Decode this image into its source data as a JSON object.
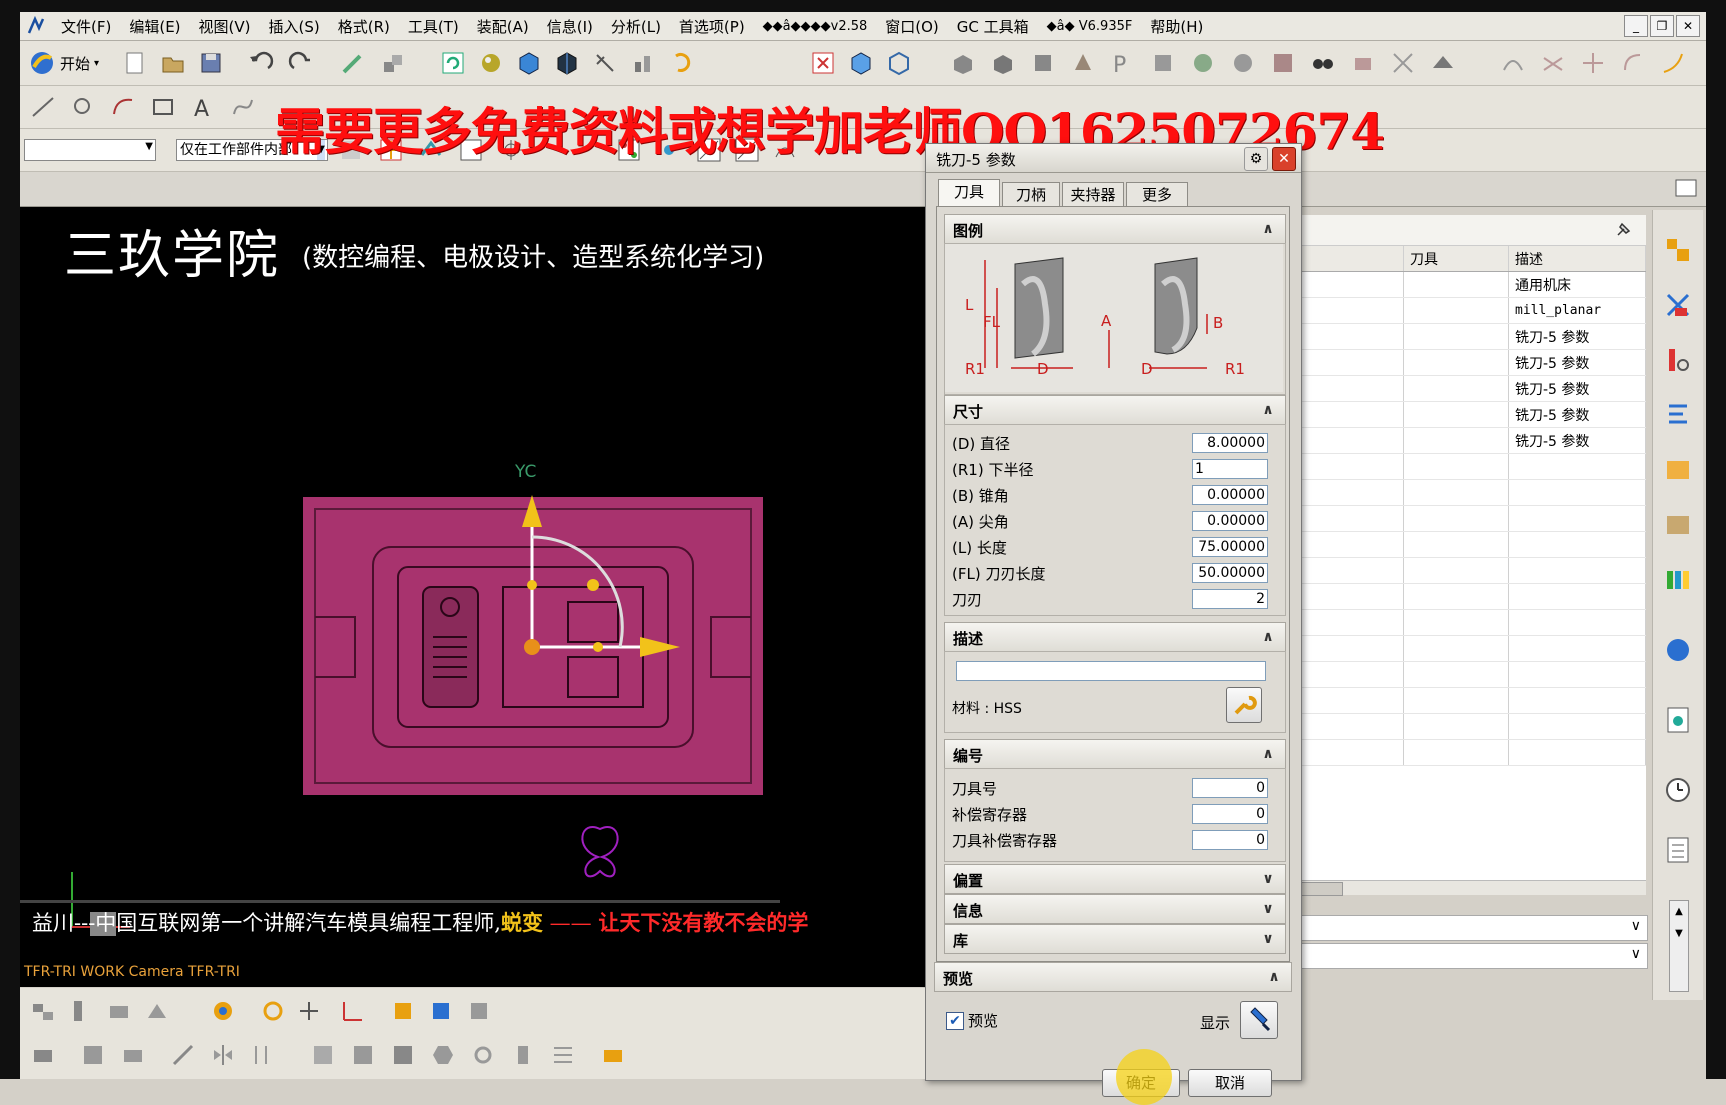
{
  "menubar": {
    "items": [
      "文件(F)",
      "编辑(E)",
      "视图(V)",
      "插入(S)",
      "格式(R)",
      "工具(T)",
      "装配(A)",
      "信息(I)",
      "分析(L)",
      "首选项(P)",
      "◆◆â◆◆◆◆v2.58",
      "窗口(O)",
      "GC 工具箱",
      "◆â◆ V6.935F",
      "帮助(H)"
    ],
    "start_label": "开始"
  },
  "filter": {
    "selection_value": "",
    "scope_value": "仅在工作部件内部"
  },
  "watermark": "需要更多免费资料或想学加老师QQ1625072674",
  "graphics": {
    "academy_title": "三玖学院",
    "academy_subtitle": "(数控编程、电极设计、造型系统化学习)",
    "axis_label": "YC",
    "caption_prefix": "益川---中国互联网第一个讲解汽车模具编程工程师,",
    "caption_highlight": "蜕变",
    "caption_dash": "——",
    "caption_slogan": "让天下没有教不会的学",
    "camera_label": "TFR-TRI WORK Camera TFR-TRI"
  },
  "navigator": {
    "columns": [
      "刀具",
      "描述"
    ],
    "rows": [
      {
        "tool": "",
        "desc": "通用机床"
      },
      {
        "tool": "",
        "desc": "mill_planar"
      },
      {
        "tool": "",
        "desc": "铣刀-5 参数"
      },
      {
        "tool": "",
        "desc": "铣刀-5 参数"
      },
      {
        "tool": "",
        "desc": "铣刀-5 参数"
      },
      {
        "tool": "",
        "desc": "铣刀-5 参数"
      },
      {
        "tool": "",
        "desc": "铣刀-5 参数"
      }
    ]
  },
  "dialog": {
    "title": "铣刀-5 参数",
    "tabs": [
      "刀具",
      "刀柄",
      "夹持器",
      "更多"
    ],
    "legend_header": "图例",
    "legend_labels": {
      "L": "L",
      "FL": "FL",
      "R1": "R1",
      "D": "D",
      "A": "A",
      "B": "B"
    },
    "dimensions_header": "尺寸",
    "dimensions": [
      {
        "label": "(D) 直径",
        "value": "8.00000"
      },
      {
        "label": "(R1) 下半径",
        "value": "1"
      },
      {
        "label": "(B) 锥角",
        "value": "0.00000"
      },
      {
        "label": "(A) 尖角",
        "value": "0.00000"
      },
      {
        "label": "(L) 长度",
        "value": "75.00000"
      },
      {
        "label": "(FL) 刀刃长度",
        "value": "50.00000"
      },
      {
        "label": "刀刃",
        "value": "2"
      }
    ],
    "description_header": "描述",
    "description_value": "",
    "material_label": "材料 : HSS",
    "numbering_header": "编号",
    "numbering": [
      {
        "label": "刀具号",
        "value": "0"
      },
      {
        "label": "补偿寄存器",
        "value": "0"
      },
      {
        "label": "刀具补偿寄存器",
        "value": "0"
      }
    ],
    "collapsed_groups": [
      "偏置",
      "信息",
      "库"
    ],
    "preview_header": "预览",
    "preview_checkbox_label": "预览",
    "display_label": "显示",
    "ok_label": "确定",
    "cancel_label": "取消"
  },
  "colors": {
    "part_magenta": "#a8336e",
    "watermark_red": "#ff0f0f",
    "axis_yellow": "#f2c21a"
  }
}
